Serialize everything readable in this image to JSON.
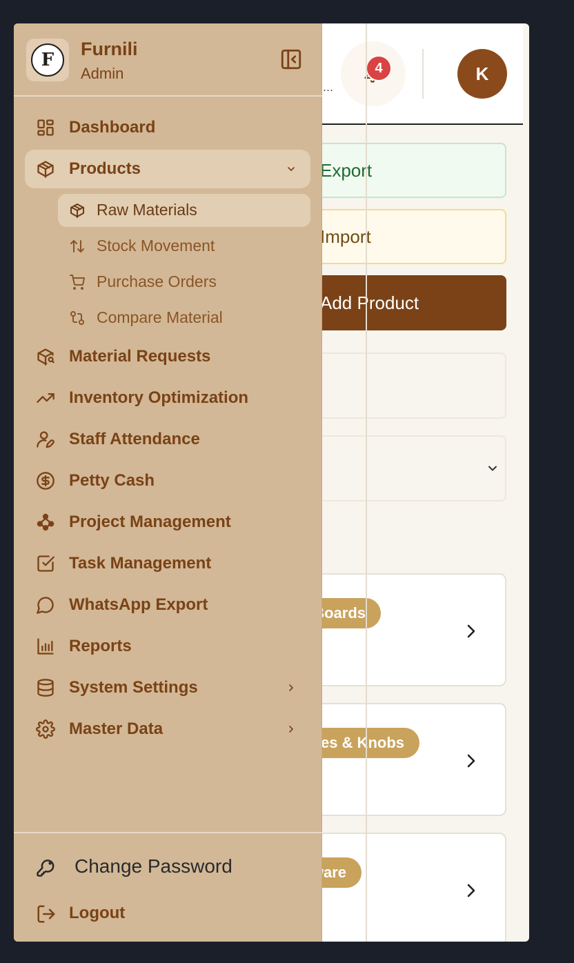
{
  "brand": {
    "name": "Furnili",
    "role": "Admin",
    "logo_letter": "F"
  },
  "header": {
    "search_tail": "...",
    "notification_count": "4",
    "avatar_initial": "K"
  },
  "main": {
    "export_button": "Export",
    "import_button": "Import",
    "add_button": "Add Product",
    "cards": [
      {
        "category": "Boards"
      },
      {
        "category": "Handles & Knobs"
      },
      {
        "category": "Hardware"
      }
    ]
  },
  "sidebar": {
    "items": [
      {
        "label": "Dashboard",
        "icon": "dashboard-icon"
      },
      {
        "label": "Products",
        "icon": "package-icon",
        "expanded": true
      },
      {
        "label": "Material Requests",
        "icon": "package-search-icon"
      },
      {
        "label": "Inventory Optimization",
        "icon": "trending-up-icon"
      },
      {
        "label": "Staff Attendance",
        "icon": "user-pen-icon"
      },
      {
        "label": "Petty Cash",
        "icon": "dollar-circle-icon"
      },
      {
        "label": "Project Management",
        "icon": "network-icon"
      },
      {
        "label": "Task Management",
        "icon": "check-square-icon"
      },
      {
        "label": "WhatsApp Export",
        "icon": "message-circle-icon"
      },
      {
        "label": "Reports",
        "icon": "bar-chart-icon"
      },
      {
        "label": "System Settings",
        "icon": "database-icon"
      },
      {
        "label": "Master Data",
        "icon": "gear-icon"
      }
    ],
    "products_sub": [
      {
        "label": "Raw Materials",
        "icon": "package-icon",
        "active": true
      },
      {
        "label": "Stock Movement",
        "icon": "arrows-up-down-icon"
      },
      {
        "label": "Purchase Orders",
        "icon": "shopping-cart-icon"
      },
      {
        "label": "Compare Material",
        "icon": "git-compare-icon"
      }
    ],
    "footer": {
      "change_password": "Change Password",
      "logout": "Logout"
    }
  },
  "colors": {
    "sidebar_bg": "#d2b897",
    "accent_brown": "#7a4216",
    "badge_red": "#d94343",
    "pill_gold": "#c9a25c"
  }
}
